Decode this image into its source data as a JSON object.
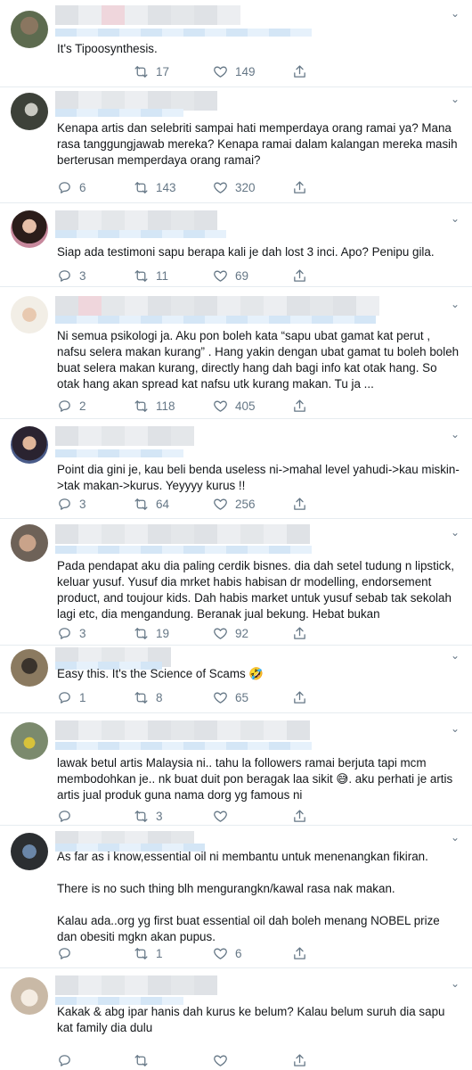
{
  "replies": [
    {
      "text": "It's Tipoosynthesis.",
      "comments": "",
      "retweets": "17",
      "likes": "149"
    },
    {
      "text": "Kenapa artis dan selebriti sampai hati memperdaya orang ramai ya? Mana rasa tanggungjawab mereka? Kenapa ramai dalam kalangan mereka masih berterusan memperdaya orang ramai?",
      "comments": "6",
      "retweets": "143",
      "likes": "320"
    },
    {
      "text": "Siap ada testimoni sapu berapa kali je dah lost 3 inci. Apo? Penipu gila.",
      "comments": "3",
      "retweets": "11",
      "likes": "69"
    },
    {
      "text": "Ni semua psikologi ja. Aku pon boleh kata “sapu ubat gamat kat perut , nafsu selera makan kurang” . Hang yakin dengan ubat gamat tu boleh boleh buat selera makan kurang, directly hang dah bagi info kat otak hang. So otak hang akan spread kat nafsu utk kurang makan. Tu ja ...",
      "comments": "2",
      "retweets": "118",
      "likes": "405"
    },
    {
      "text": "Point dia gini je, kau beli benda useless ni->mahal level yahudi->kau miskin->tak makan->kurus. Yeyyyy kurus !!",
      "comments": "3",
      "retweets": "64",
      "likes": "256"
    },
    {
      "text": "Pada pendapat aku dia paling cerdik bisnes. dia dah setel tudung n lipstick, keluar yusuf. Yusuf dia mrket habis habisan dr modelling, endorsement product, and toujour kids. Dah habis market untuk yusuf sebab tak sekolah lagi etc, dia mengandung. Beranak jual bekung. Hebat bukan",
      "comments": "3",
      "retweets": "19",
      "likes": "92"
    },
    {
      "text": "Easy this. It's the Science of Scams 🤣",
      "comments": "1",
      "retweets": "8",
      "likes": "65"
    },
    {
      "text": "lawak betul artis Malaysia ni.. tahu la followers ramai berjuta tapi mcm membodohkan je.. nk buat duit pon beragak laa sikit 😅. aku perhati je artis artis jual produk guna nama dorg yg famous ni",
      "comments": "",
      "retweets": "3",
      "likes": ""
    },
    {
      "text": "As far as i know,essential oil ni membantu untuk menenangkan fikiran.\n\nThere is no such thing blh mengurangkn/kawal rasa nak makan.\n\nKalau ada..org yg first buat essential oil dah boleh menang NOBEL prize dan obesiti mgkn akan pupus.",
      "comments": "",
      "retweets": "1",
      "likes": "6"
    },
    {
      "text": "Kakak & abg ipar hanis dah kurus ke belum? Kalau belum suruh dia sapu kat family dia dulu",
      "comments": "",
      "retweets": "",
      "likes": ""
    }
  ],
  "icons": {
    "comment": "speech-bubble-icon",
    "retweet": "retweet-icon",
    "like": "heart-icon",
    "share": "share-icon",
    "more": "chevron-down-icon"
  },
  "colors": {
    "icon_gray": "#657786",
    "text": "#14171a",
    "divider": "#e6ecf0"
  }
}
